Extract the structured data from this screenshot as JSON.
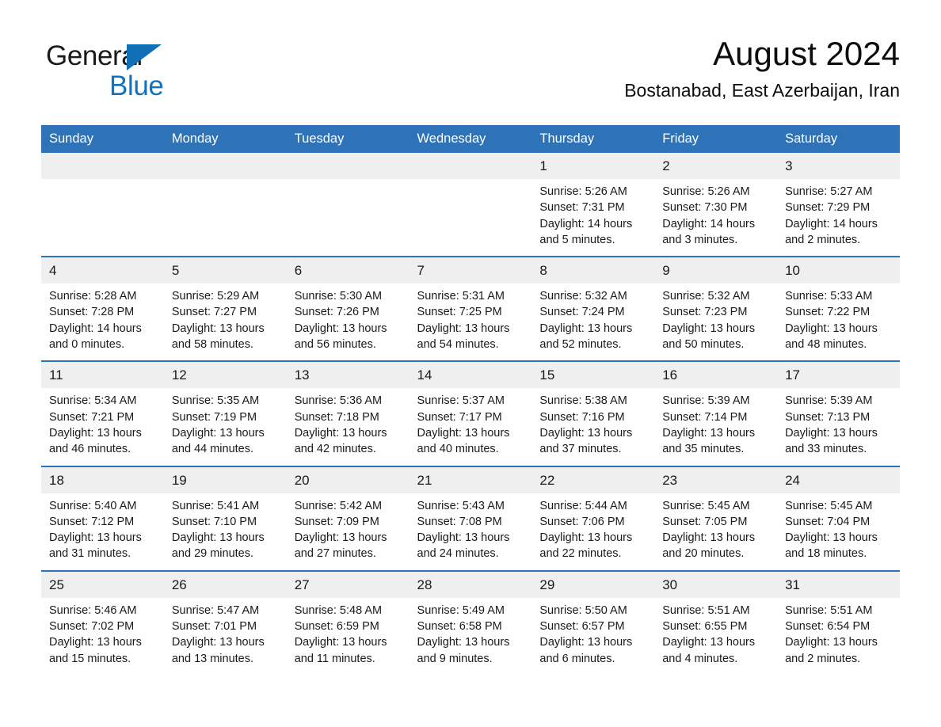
{
  "brand": {
    "name_part1": "General",
    "name_part2": "Blue",
    "triangle_color": "#116fb5",
    "blue_color": "#1272bb"
  },
  "header": {
    "title": "August 2024",
    "subtitle": "Bostanabad, East Azerbaijan, Iran"
  },
  "theme": {
    "header_blue": "#2e72b8",
    "daynum_gray": "#efefef",
    "text": "#1a1a1a",
    "page_bg": "#ffffff"
  },
  "calendar": {
    "weekday_headers": [
      "Sunday",
      "Monday",
      "Tuesday",
      "Wednesday",
      "Thursday",
      "Friday",
      "Saturday"
    ],
    "weeks": [
      [
        {
          "day": "",
          "sunrise": "",
          "sunset": "",
          "daylight": ""
        },
        {
          "day": "",
          "sunrise": "",
          "sunset": "",
          "daylight": ""
        },
        {
          "day": "",
          "sunrise": "",
          "sunset": "",
          "daylight": ""
        },
        {
          "day": "",
          "sunrise": "",
          "sunset": "",
          "daylight": ""
        },
        {
          "day": "1",
          "sunrise": "Sunrise: 5:26 AM",
          "sunset": "Sunset: 7:31 PM",
          "daylight": "Daylight: 14 hours and 5 minutes."
        },
        {
          "day": "2",
          "sunrise": "Sunrise: 5:26 AM",
          "sunset": "Sunset: 7:30 PM",
          "daylight": "Daylight: 14 hours and 3 minutes."
        },
        {
          "day": "3",
          "sunrise": "Sunrise: 5:27 AM",
          "sunset": "Sunset: 7:29 PM",
          "daylight": "Daylight: 14 hours and 2 minutes."
        }
      ],
      [
        {
          "day": "4",
          "sunrise": "Sunrise: 5:28 AM",
          "sunset": "Sunset: 7:28 PM",
          "daylight": "Daylight: 14 hours and 0 minutes."
        },
        {
          "day": "5",
          "sunrise": "Sunrise: 5:29 AM",
          "sunset": "Sunset: 7:27 PM",
          "daylight": "Daylight: 13 hours and 58 minutes."
        },
        {
          "day": "6",
          "sunrise": "Sunrise: 5:30 AM",
          "sunset": "Sunset: 7:26 PM",
          "daylight": "Daylight: 13 hours and 56 minutes."
        },
        {
          "day": "7",
          "sunrise": "Sunrise: 5:31 AM",
          "sunset": "Sunset: 7:25 PM",
          "daylight": "Daylight: 13 hours and 54 minutes."
        },
        {
          "day": "8",
          "sunrise": "Sunrise: 5:32 AM",
          "sunset": "Sunset: 7:24 PM",
          "daylight": "Daylight: 13 hours and 52 minutes."
        },
        {
          "day": "9",
          "sunrise": "Sunrise: 5:32 AM",
          "sunset": "Sunset: 7:23 PM",
          "daylight": "Daylight: 13 hours and 50 minutes."
        },
        {
          "day": "10",
          "sunrise": "Sunrise: 5:33 AM",
          "sunset": "Sunset: 7:22 PM",
          "daylight": "Daylight: 13 hours and 48 minutes."
        }
      ],
      [
        {
          "day": "11",
          "sunrise": "Sunrise: 5:34 AM",
          "sunset": "Sunset: 7:21 PM",
          "daylight": "Daylight: 13 hours and 46 minutes."
        },
        {
          "day": "12",
          "sunrise": "Sunrise: 5:35 AM",
          "sunset": "Sunset: 7:19 PM",
          "daylight": "Daylight: 13 hours and 44 minutes."
        },
        {
          "day": "13",
          "sunrise": "Sunrise: 5:36 AM",
          "sunset": "Sunset: 7:18 PM",
          "daylight": "Daylight: 13 hours and 42 minutes."
        },
        {
          "day": "14",
          "sunrise": "Sunrise: 5:37 AM",
          "sunset": "Sunset: 7:17 PM",
          "daylight": "Daylight: 13 hours and 40 minutes."
        },
        {
          "day": "15",
          "sunrise": "Sunrise: 5:38 AM",
          "sunset": "Sunset: 7:16 PM",
          "daylight": "Daylight: 13 hours and 37 minutes."
        },
        {
          "day": "16",
          "sunrise": "Sunrise: 5:39 AM",
          "sunset": "Sunset: 7:14 PM",
          "daylight": "Daylight: 13 hours and 35 minutes."
        },
        {
          "day": "17",
          "sunrise": "Sunrise: 5:39 AM",
          "sunset": "Sunset: 7:13 PM",
          "daylight": "Daylight: 13 hours and 33 minutes."
        }
      ],
      [
        {
          "day": "18",
          "sunrise": "Sunrise: 5:40 AM",
          "sunset": "Sunset: 7:12 PM",
          "daylight": "Daylight: 13 hours and 31 minutes."
        },
        {
          "day": "19",
          "sunrise": "Sunrise: 5:41 AM",
          "sunset": "Sunset: 7:10 PM",
          "daylight": "Daylight: 13 hours and 29 minutes."
        },
        {
          "day": "20",
          "sunrise": "Sunrise: 5:42 AM",
          "sunset": "Sunset: 7:09 PM",
          "daylight": "Daylight: 13 hours and 27 minutes."
        },
        {
          "day": "21",
          "sunrise": "Sunrise: 5:43 AM",
          "sunset": "Sunset: 7:08 PM",
          "daylight": "Daylight: 13 hours and 24 minutes."
        },
        {
          "day": "22",
          "sunrise": "Sunrise: 5:44 AM",
          "sunset": "Sunset: 7:06 PM",
          "daylight": "Daylight: 13 hours and 22 minutes."
        },
        {
          "day": "23",
          "sunrise": "Sunrise: 5:45 AM",
          "sunset": "Sunset: 7:05 PM",
          "daylight": "Daylight: 13 hours and 20 minutes."
        },
        {
          "day": "24",
          "sunrise": "Sunrise: 5:45 AM",
          "sunset": "Sunset: 7:04 PM",
          "daylight": "Daylight: 13 hours and 18 minutes."
        }
      ],
      [
        {
          "day": "25",
          "sunrise": "Sunrise: 5:46 AM",
          "sunset": "Sunset: 7:02 PM",
          "daylight": "Daylight: 13 hours and 15 minutes."
        },
        {
          "day": "26",
          "sunrise": "Sunrise: 5:47 AM",
          "sunset": "Sunset: 7:01 PM",
          "daylight": "Daylight: 13 hours and 13 minutes."
        },
        {
          "day": "27",
          "sunrise": "Sunrise: 5:48 AM",
          "sunset": "Sunset: 6:59 PM",
          "daylight": "Daylight: 13 hours and 11 minutes."
        },
        {
          "day": "28",
          "sunrise": "Sunrise: 5:49 AM",
          "sunset": "Sunset: 6:58 PM",
          "daylight": "Daylight: 13 hours and 9 minutes."
        },
        {
          "day": "29",
          "sunrise": "Sunrise: 5:50 AM",
          "sunset": "Sunset: 6:57 PM",
          "daylight": "Daylight: 13 hours and 6 minutes."
        },
        {
          "day": "30",
          "sunrise": "Sunrise: 5:51 AM",
          "sunset": "Sunset: 6:55 PM",
          "daylight": "Daylight: 13 hours and 4 minutes."
        },
        {
          "day": "31",
          "sunrise": "Sunrise: 5:51 AM",
          "sunset": "Sunset: 6:54 PM",
          "daylight": "Daylight: 13 hours and 2 minutes."
        }
      ]
    ]
  }
}
